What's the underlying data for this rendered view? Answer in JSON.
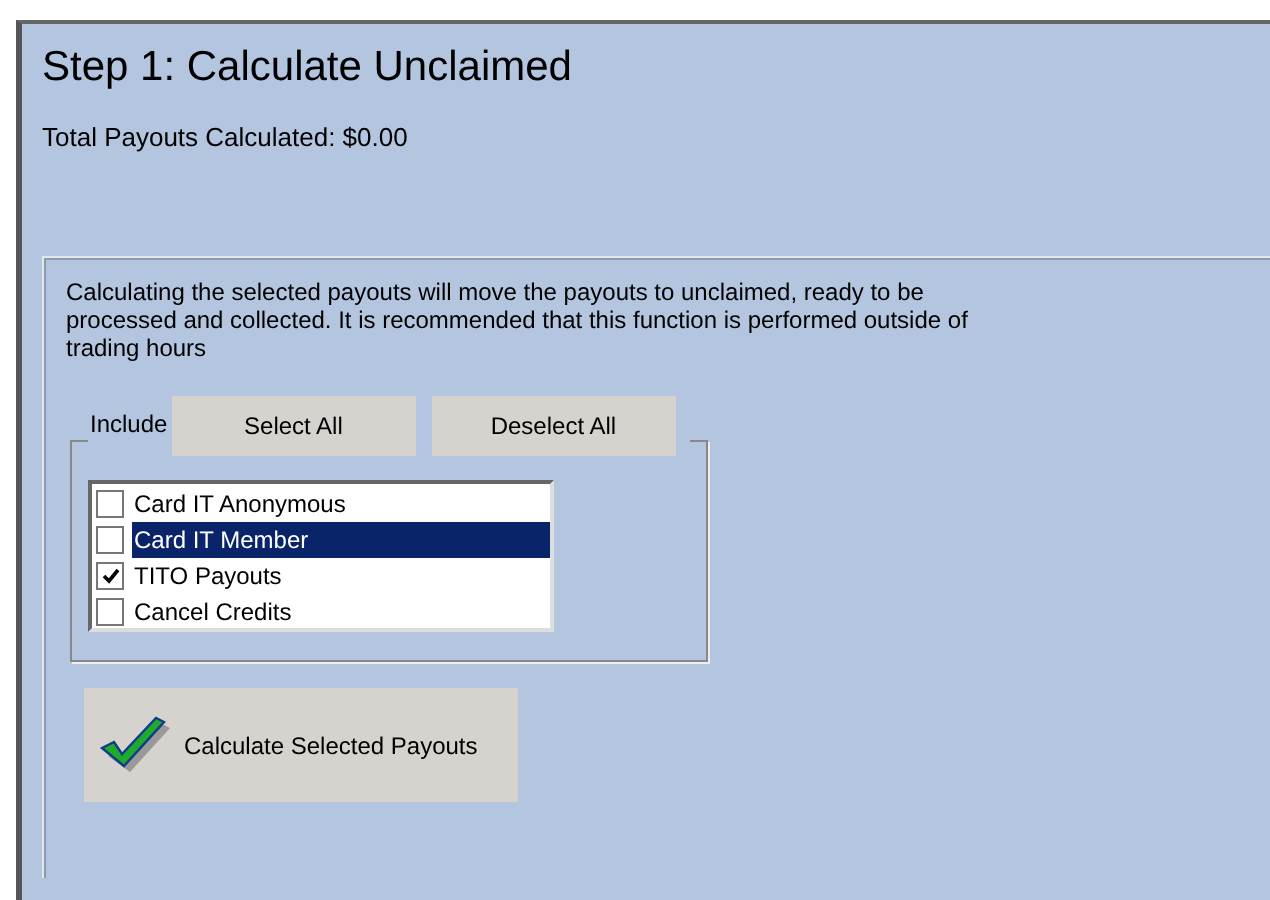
{
  "title": "Step 1: Calculate Unclaimed",
  "total": "Total Payouts Calculated: $0.00",
  "description": "Calculating the selected payouts will move the payouts to unclaimed, ready to be processed and collected. It is recommended that this function is performed outside of trading hours",
  "include_group": {
    "label": "Include",
    "buttons": [
      "Select All",
      "Deselect All"
    ],
    "items": [
      {
        "label": "Card IT Anonymous",
        "checked": false,
        "selected": false
      },
      {
        "label": "Card IT Member",
        "checked": false,
        "selected": true
      },
      {
        "label": "TITO Payouts",
        "checked": true,
        "selected": false
      },
      {
        "label": "Cancel Credits",
        "checked": false,
        "selected": false
      }
    ]
  },
  "action_button": "Calculate Selected Payouts"
}
